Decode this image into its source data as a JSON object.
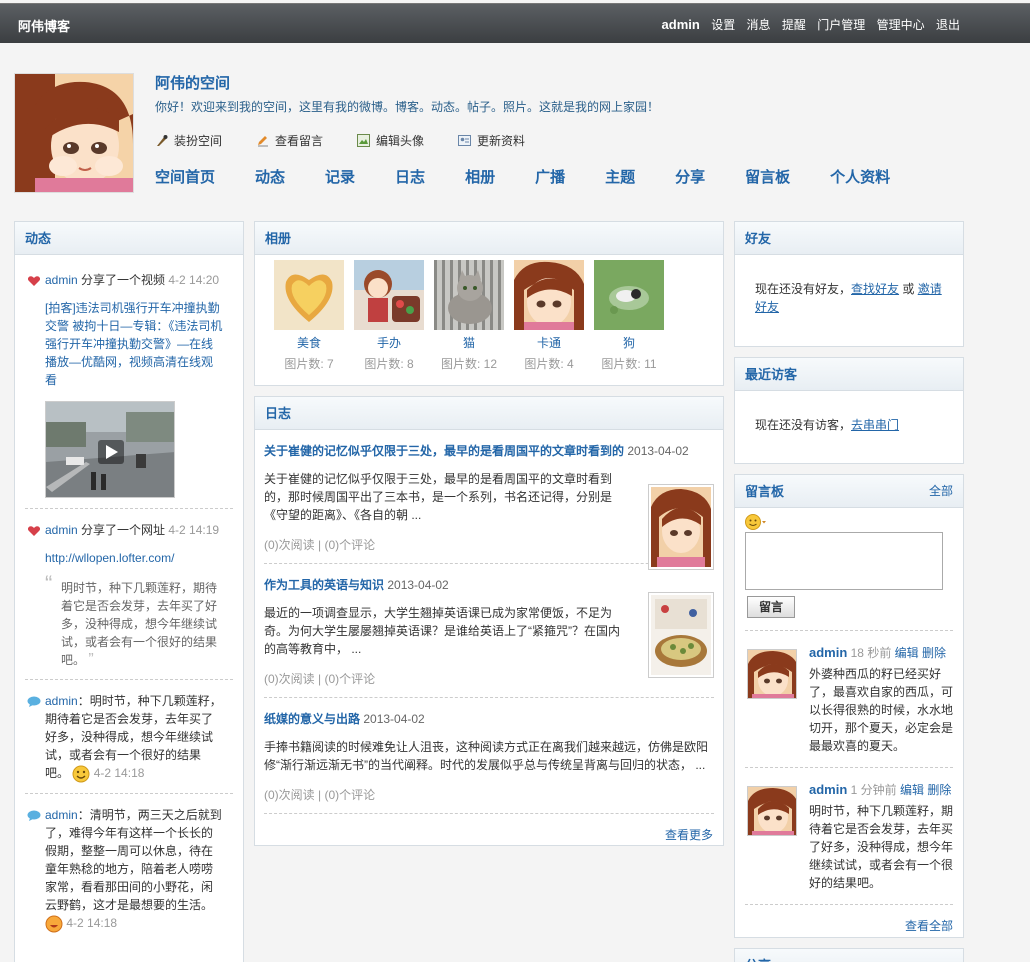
{
  "topbar": {
    "brand": "阿伟博客",
    "user": "admin",
    "links": [
      "设置",
      "消息",
      "提醒",
      "门户管理",
      "管理中心",
      "退出"
    ]
  },
  "header": {
    "title": "阿伟的空间",
    "desc": "你好！欢迎来到我的空间，这里有我的微博。博客。动态。帖子。照片。这就是我的网上家园！",
    "actions": [
      "装扮空间",
      "查看留言",
      "编辑头像",
      "更新资料"
    ],
    "nav": [
      "空间首页",
      "动态",
      "记录",
      "日志",
      "相册",
      "广播",
      "主题",
      "分享",
      "留言板",
      "个人资料"
    ]
  },
  "feed": {
    "title": "动态",
    "items": [
      {
        "user": "admin",
        "action": " 分享了一个视频 ",
        "time": "4-2 14:20",
        "link": "[拍客]违法司机强行开车冲撞执勤交警 被拘十日—专辑：《违法司机强行开车冲撞执勤交警》—在线播放—优酷网，视频高清在线观看"
      },
      {
        "user": "admin",
        "action": " 分享了一个网址 ",
        "time": "4-2 14:19",
        "link": "http://wllopen.lofter.com/",
        "quote": "明时节，种下几颗莲籽，期待着它是否会发芽，去年买了好多，没种得成，想今年继续试试，或者会有一个很好的结果吧。"
      },
      {
        "user": "admin",
        "text": "：明时节，种下几颗莲籽，期待着它是否会发芽，去年买了好多，没种得成，想今年继续试试，或者会有一个很好的结果吧。",
        "time": "4-2 14:18"
      },
      {
        "user": "admin",
        "text": "：清明节，两三天之后就到了，难得今年有这样一个长长的假期，整整一周可以休息，待在童年熟稔的地方，陪着老人唠唠家常，看看那田间的小野花，闲云野鹤，这才是最想要的生活。",
        "time": "4-2 14:18"
      }
    ]
  },
  "albums": {
    "title": "相册",
    "items": [
      {
        "name": "美食",
        "count": "图片数: 7"
      },
      {
        "name": "手办",
        "count": "图片数: 8"
      },
      {
        "name": "猫",
        "count": "图片数: 12"
      },
      {
        "name": "卡通",
        "count": "图片数: 4"
      },
      {
        "name": "狗",
        "count": "图片数: 11"
      }
    ]
  },
  "blogs": {
    "title": "日志",
    "more": "查看更多",
    "items": [
      {
        "title": "关于崔健的记忆似乎仅限于三处，最早的是看周国平的文章时看到的",
        "date": " 2013-04-02",
        "body": "关于崔健的记忆似乎仅限于三处，最早的是看周国平的文章时看到的，那时候周国平出了三本书，是一个系列，书名还记得，分别是《守望的距离》、《各自的朝 ...",
        "stats": "(0)次阅读 | (0)个评论"
      },
      {
        "title": "作为工具的英语与知识",
        "date": " 2013-04-02",
        "body": "最近的一项调查显示，大学生翘掉英语课已成为家常便饭，不足为奇。为何大学生屡屡翘掉英语课？是谁给英语上了“紧箍咒”？在国内的高等教育中， ...",
        "stats": "(0)次阅读 | (0)个评论"
      },
      {
        "title": "纸媒的意义与出路",
        "date": " 2013-04-02",
        "body": "手捧书籍阅读的时候难免让人沮丧，这种阅读方式正在离我们越来越远，仿佛是欧阳修“渐行渐远渐无书”的当代阐释。时代的发展似乎总与传统呈背离与回归的状态， ...",
        "stats": "(0)次阅读 | (0)个评论"
      }
    ]
  },
  "friends": {
    "title": "好友",
    "text": "现在还没有好友，",
    "link1": "查找好友",
    "or": " 或 ",
    "link2": "邀请好友"
  },
  "visitors": {
    "title": "最近访客",
    "text": "现在还没有访客，",
    "link": "去串串门"
  },
  "guestbook": {
    "title": "留言板",
    "all": "全部",
    "button": "留言",
    "view_all": "查看全部",
    "entries": [
      {
        "name": "admin",
        "time": " 18 秒前 ",
        "edit": "编辑",
        "del": "删除",
        "text": "外婆种西瓜的籽已经买好了，最喜欢自家的西瓜，可以长得很熟的时候，水水地切开，那个夏天，必定会是最最欢喜的夏天。"
      },
      {
        "name": "admin",
        "time": " 1 分钟前 ",
        "edit": "编辑",
        "del": "删除",
        "text": "明时节，种下几颗莲籽，期待着它是否会发芽，去年买了好多，没种得成，想今年继续试试，或者会有一个很好的结果吧。"
      }
    ]
  },
  "share": {
    "title": "分享"
  }
}
